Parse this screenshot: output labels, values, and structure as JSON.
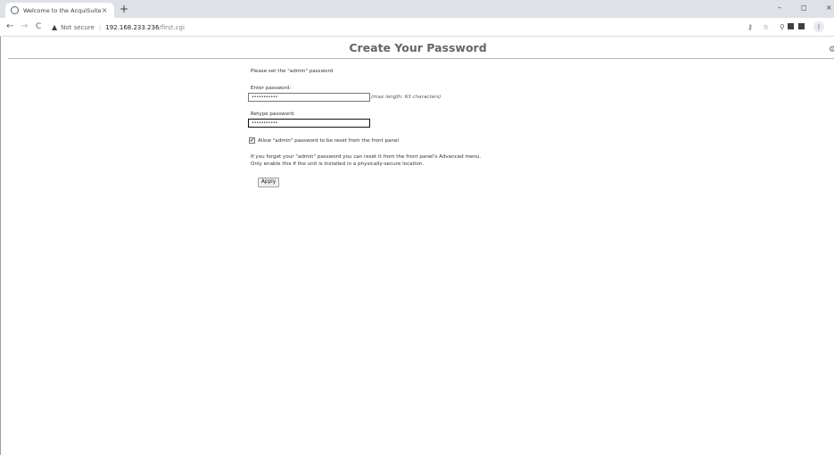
{
  "browser": {
    "tab_title": "Welcome to the AcquiSuite",
    "tab_close": "×",
    "new_tab": "+",
    "window_controls": [
      "–",
      "◻",
      "×"
    ],
    "nav": {
      "back": "←",
      "forward": "→",
      "reload": "C"
    },
    "security_label": "Not secure",
    "url_host": "192.168.233.236",
    "url_path": "/first.cgi",
    "icons": [
      "key-icon",
      "star-icon",
      "pin-icon",
      "extension-icon",
      "puzzle-icon",
      "profile-icon"
    ]
  },
  "page": {
    "title": "Create Your Password",
    "intro": "Please set the \"admin\" password",
    "enter_label": "Enter password:",
    "enter_value": "•••••••••••",
    "max_hint": "(max length: 63 characters)",
    "retype_label": "Retype password:",
    "retype_value": "•••••••••••",
    "reset_checkbox_checked": true,
    "reset_checkbox_mark": "✔",
    "reset_label": "Allow \"admin\" password to be reset from the front panel",
    "info_line1": "If you forget your \"admin\" password you can reset it from the front panel's Advanced menu.",
    "info_line2": "Only enable this if the unit is installed in a physically-secure location.",
    "apply_label": "Apply"
  }
}
